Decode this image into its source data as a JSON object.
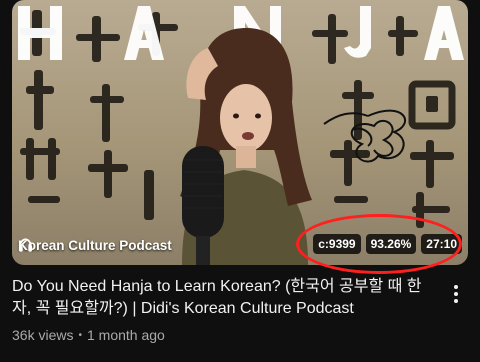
{
  "thumbnail": {
    "channel_overlay": "Korean Culture Podcast",
    "headphone_icon": "headphones-icon",
    "comment_count": "c:9399",
    "percent": "93.26%",
    "duration": "27:10",
    "annotation_color": "#ff1f1f",
    "hanja_letters": [
      "H",
      "A",
      "N",
      "J",
      "A"
    ]
  },
  "video": {
    "title": "Do You Need Hanja to Learn Korean? (한국어 공부할 때 한자, 꼭 필요할까?) | Didi's Korean Culture Podcast",
    "views": "36k views",
    "age": "1 month ago",
    "menu_icon": "more-vert-icon"
  }
}
